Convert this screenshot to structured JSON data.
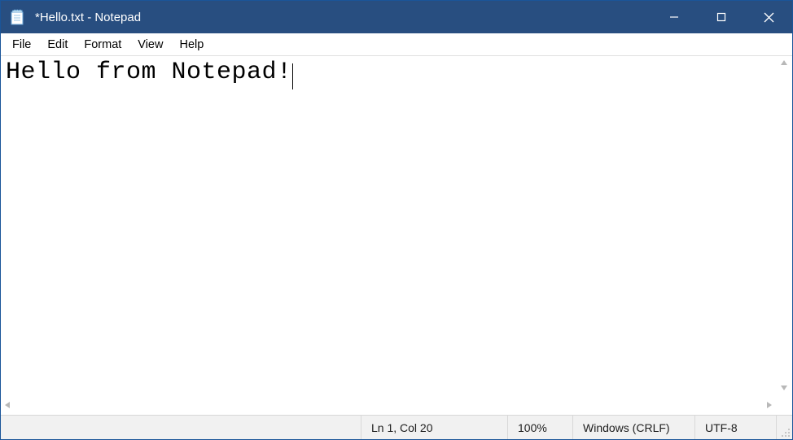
{
  "window": {
    "title": "*Hello.txt - Notepad"
  },
  "menu": {
    "items": [
      "File",
      "Edit",
      "Format",
      "View",
      "Help"
    ]
  },
  "editor": {
    "content": "Hello from Notepad!"
  },
  "status": {
    "position": "Ln 1, Col 20",
    "zoom": "100%",
    "line_ending": "Windows (CRLF)",
    "encoding": "UTF-8"
  }
}
